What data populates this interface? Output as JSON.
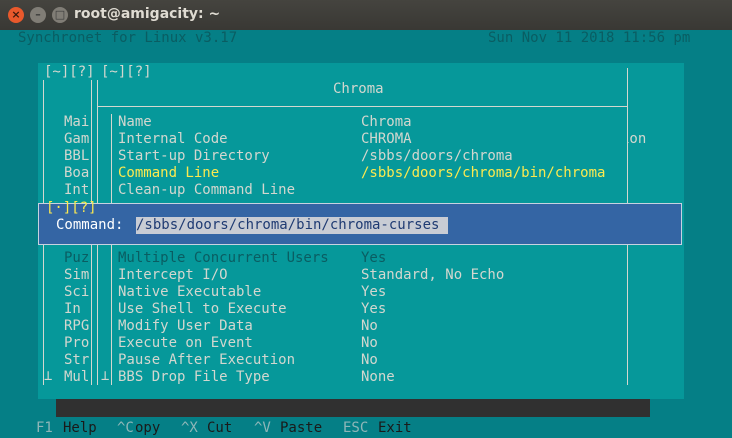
{
  "window": {
    "title": "root@amigacity: ~"
  },
  "header": {
    "app": "Synchronet for Linux v3.17",
    "datetime": "Sun Nov 11 2018 11:56 pm"
  },
  "back_panel": {
    "title_markers": "[~][?]",
    "items": [
      "Mai",
      "Gam",
      "BBL",
      "Boa",
      "Int",
      "",
      "Puz",
      "Sim",
      "Sci",
      "In ",
      "RPG",
      "Pro",
      "Str",
      "Mul"
    ],
    "scroll_marker": "⊥",
    "right_fragment": "ion"
  },
  "main_panel": {
    "title_markers": "[~][?]",
    "title": "Chroma",
    "rows": [
      {
        "label": "Name",
        "value": "Chroma"
      },
      {
        "label": "Internal Code",
        "value": "CHROMA"
      },
      {
        "label": "Start-up Directory",
        "value": "/sbbs/doors/chroma"
      },
      {
        "label": "Command Line",
        "value": "/sbbs/doors/chroma/bin/chroma"
      },
      {
        "label": "Clean-up Command Line",
        "value": ""
      },
      {
        "label": "Multiple Concurrent Users",
        "value": "Yes"
      },
      {
        "label": "Intercept I/O",
        "value": "Standard, No Echo"
      },
      {
        "label": "Native Executable",
        "value": "Yes"
      },
      {
        "label": "Use Shell to Execute",
        "value": "Yes"
      },
      {
        "label": "Modify User Data",
        "value": "No"
      },
      {
        "label": "Execute on Event",
        "value": "No"
      },
      {
        "label": "Pause After Execution",
        "value": "No"
      },
      {
        "label": "BBS Drop File Type",
        "value": "None"
      }
    ]
  },
  "command_popup": {
    "title_markers": "[·][?]",
    "label": "Command:",
    "value": "/sbbs/doors/chroma/bin/chroma-curses"
  },
  "footer": {
    "items": [
      {
        "key": "F1",
        "label": "Help"
      },
      {
        "key": "^C",
        "label": "opy"
      },
      {
        "key": "^X",
        "label": "Cut"
      },
      {
        "key": "^V",
        "label": "Paste"
      },
      {
        "key": "ESC",
        "label": "Exit"
      }
    ]
  },
  "colors": {
    "terminal_bg": "#057f86",
    "panel_bg": "#06989a",
    "highlight": "#fce94f",
    "popup_bg": "#3465a4"
  }
}
